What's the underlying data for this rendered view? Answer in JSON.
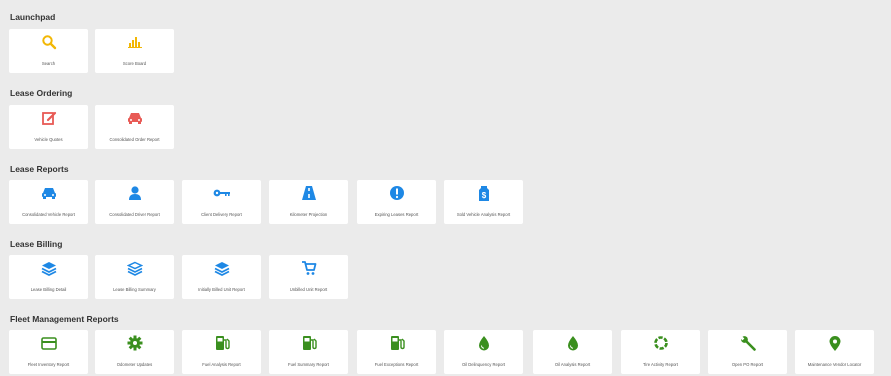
{
  "colors": {
    "blue": "#1e88e5",
    "gold": "#f2b705",
    "red": "#e85a55",
    "green": "#3a8f1e"
  },
  "launchpad": {
    "title": "Launchpad",
    "tiles": [
      {
        "label": "Search",
        "icon": "search-icon"
      },
      {
        "label": "Score Board",
        "icon": "bar-chart-icon"
      }
    ]
  },
  "lease_ordering": {
    "title": "Lease Ordering",
    "tiles": [
      {
        "label": "Vehicle Quotes",
        "icon": "edit-icon"
      },
      {
        "label": "Consolidated Order Report",
        "icon": "car-icon"
      }
    ]
  },
  "lease_reports": {
    "title": "Lease Reports",
    "tiles": [
      {
        "label": "Consolidated Vehicle Report",
        "icon": "car-icon"
      },
      {
        "label": "Consolidated Driver Report",
        "icon": "driver-icon"
      },
      {
        "label": "Client Delivery Report",
        "icon": "key-icon"
      },
      {
        "label": "Kilometer Projection",
        "icon": "road-icon"
      },
      {
        "label": "Expiring Leases Report",
        "icon": "alert-icon"
      },
      {
        "label": "Sold Vehicle Analysis Report",
        "icon": "price-tag-icon"
      }
    ]
  },
  "lease_billing": {
    "title": "Lease Billing",
    "tiles": [
      {
        "label": "Lease Billing Detail",
        "icon": "layers-icon"
      },
      {
        "label": "Lease Billing Summary",
        "icon": "layers-outline-icon"
      },
      {
        "label": "Initially Billed Unit Report",
        "icon": "layers-icon"
      },
      {
        "label": "Unbilled Unit Report",
        "icon": "cart-icon"
      }
    ]
  },
  "fleet_management": {
    "title": "Fleet Management Reports",
    "tiles": [
      {
        "label": "Fleet Inventory Report",
        "icon": "card-icon"
      },
      {
        "label": "Odometer Updates",
        "icon": "gear-icon"
      },
      {
        "label": "Fuel Analysis Report",
        "icon": "fuel-pump-icon"
      },
      {
        "label": "Fuel Summary Report",
        "icon": "fuel-pump-icon"
      },
      {
        "label": "Fuel Exceptions Report",
        "icon": "fuel-pump-icon"
      },
      {
        "label": "Oil Delinquency Report",
        "icon": "oil-drop-icon"
      },
      {
        "label": "Oil Analysis Report",
        "icon": "oil-drop-icon"
      },
      {
        "label": "Tire Activity Report",
        "icon": "tire-icon"
      },
      {
        "label": "Open PO Report",
        "icon": "wrench-icon"
      },
      {
        "label": "Maintenance Vendor Locator",
        "icon": "map-pin-icon"
      }
    ]
  }
}
